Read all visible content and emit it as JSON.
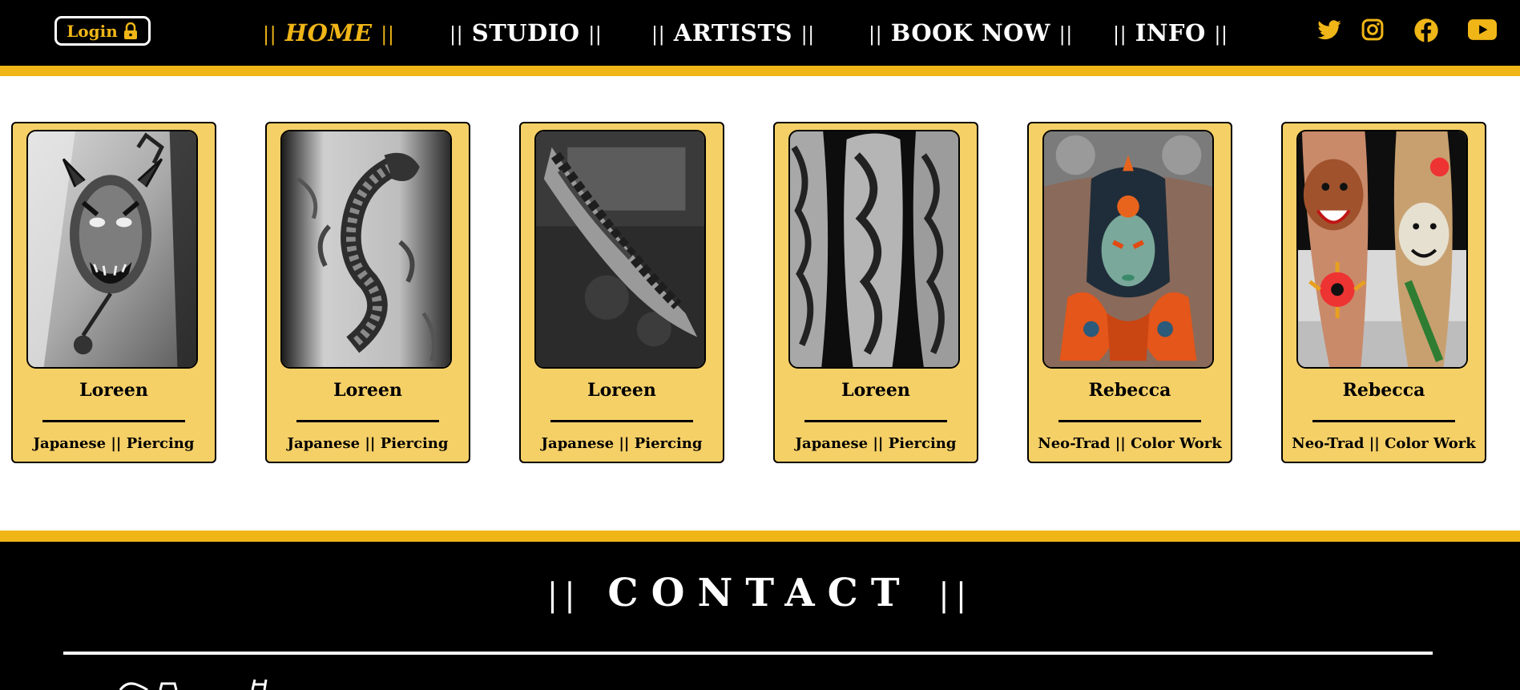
{
  "header": {
    "login_label": "Login",
    "nav": [
      {
        "label": "HOME",
        "prefix": "||",
        "suffix": "||",
        "active": true
      },
      {
        "label": "STUDIO",
        "prefix": "||",
        "suffix": "||",
        "active": false
      },
      {
        "label": "ARTISTS",
        "prefix": "||",
        "suffix": "||",
        "active": false
      },
      {
        "label": "BOOK NOW",
        "prefix": "||",
        "suffix": "||",
        "active": false
      },
      {
        "label": "INFO",
        "prefix": "||",
        "suffix": "||",
        "active": false
      }
    ],
    "social_icons": [
      "twitter-icon",
      "instagram-icon",
      "facebook-icon",
      "youtube-icon"
    ]
  },
  "cards": [
    {
      "name": "Loreen",
      "styles": "Japanese || Piercing",
      "image": "hannya-mask-tattoo"
    },
    {
      "name": "Loreen",
      "styles": "Japanese || Piercing",
      "image": "dragon-back-tattoo"
    },
    {
      "name": "Loreen",
      "styles": "Japanese || Piercing",
      "image": "arm-sleeve-tattoo"
    },
    {
      "name": "Loreen",
      "styles": "Japanese || Piercing",
      "image": "three-sleeves-tattoo"
    },
    {
      "name": "Rebecca",
      "styles": "Neo-Trad || Color Work",
      "image": "geisha-chest-tattoo"
    },
    {
      "name": "Rebecca",
      "styles": "Neo-Trad || Color Work",
      "image": "bear-legs-tattoo"
    }
  ],
  "contact": {
    "title": "CONTACT",
    "prefix": "||",
    "suffix": "||"
  },
  "colors": {
    "accent": "#f0b617",
    "card_bg": "#f5d067",
    "dark": "#000000",
    "light": "#ffffff"
  }
}
